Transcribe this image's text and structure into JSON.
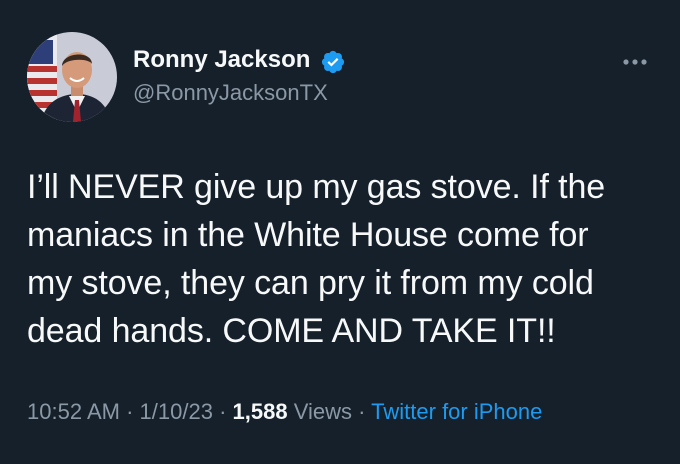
{
  "author": {
    "name": "Ronny Jackson",
    "handle": "@RonnyJacksonTX",
    "verified": true,
    "avatar_icon": "profile-photo"
  },
  "tweet": {
    "lines": [
      "I’ll NEVER give up my gas stove. If the",
      "maniacs in the White House come for",
      "my stove, they can pry it from my cold",
      "dead hands. COME AND TAKE IT!!"
    ]
  },
  "meta": {
    "time": "10:52 AM",
    "date": "1/10/23",
    "views_count": "1,588",
    "views_label": "Views",
    "source": "Twitter for iPhone",
    "separator": "·"
  },
  "colors": {
    "background": "#15202b",
    "text": "#f7f9f9",
    "secondary": "#8b98a5",
    "accent": "#1d9bf0"
  },
  "icons": {
    "verified": "verified-badge-icon",
    "more": "more-options-icon"
  }
}
